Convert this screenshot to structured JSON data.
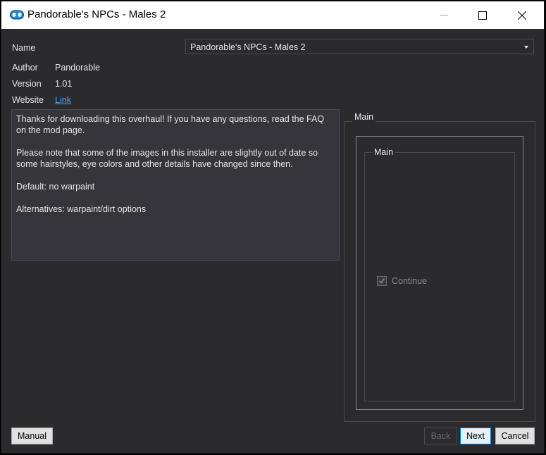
{
  "window": {
    "title": "Pandorable's NPCs - Males 2",
    "icon": "mod-organizer-icon"
  },
  "info": {
    "name_label": "Name",
    "name_value": "Pandorable's NPCs - Males 2",
    "author_label": "Author",
    "author_value": "Pandorable",
    "version_label": "Version",
    "version_value": "1.01",
    "website_label": "Website",
    "website_link": "Link"
  },
  "description": {
    "p1": "Thanks for downloading this overhaul! If you have any questions, read the FAQ on the mod page.",
    "p2": "Please note that some of the images in this installer are slightly out of date so some hairstyles, eye colors and other details have changed since then.",
    "p3": "Default: no warpaint",
    "p4": "Alternatives: warpaint/dirt options"
  },
  "options": {
    "outer_title": "Main",
    "inner_title": "Main",
    "checkbox_label": "Continue",
    "checkbox_checked": true
  },
  "buttons": {
    "manual": "Manual",
    "back": "Back",
    "next": "Next",
    "cancel": "Cancel"
  },
  "colors": {
    "background": "#2b2b2e",
    "link": "#4da3ff",
    "accent": "#0078d7"
  }
}
